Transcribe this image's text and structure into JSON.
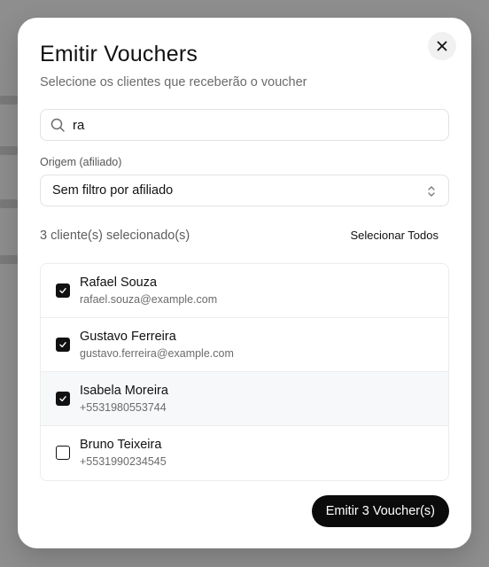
{
  "modal": {
    "title": "Emitir Vouchers",
    "subtitle": "Selecione os clientes que receberão o voucher"
  },
  "search": {
    "value": "ra",
    "icon": "search-icon"
  },
  "affiliate_filter": {
    "label": "Origem (afiliado)",
    "value": "Sem filtro por afiliado",
    "icon": "chevron-up-down-icon"
  },
  "selection": {
    "count_text": "3 cliente(s) selecionado(s)",
    "select_all_label": "Selecionar Todos"
  },
  "clients": [
    {
      "name": "Rafael Souza",
      "contact": "rafael.souza@example.com",
      "checked": true
    },
    {
      "name": "Gustavo Ferreira",
      "contact": "gustavo.ferreira@example.com",
      "checked": true
    },
    {
      "name": "Isabela Moreira",
      "contact": "+5531980553744",
      "checked": true
    },
    {
      "name": "Bruno Teixeira",
      "contact": "+5531990234545",
      "checked": false
    }
  ],
  "footer": {
    "emit_label": "Emitir 3 Voucher(s)"
  },
  "colors": {
    "primary": "#0b0b0b",
    "backdrop": "#8e8e8e",
    "highlight_row": "#f7f8fa"
  }
}
